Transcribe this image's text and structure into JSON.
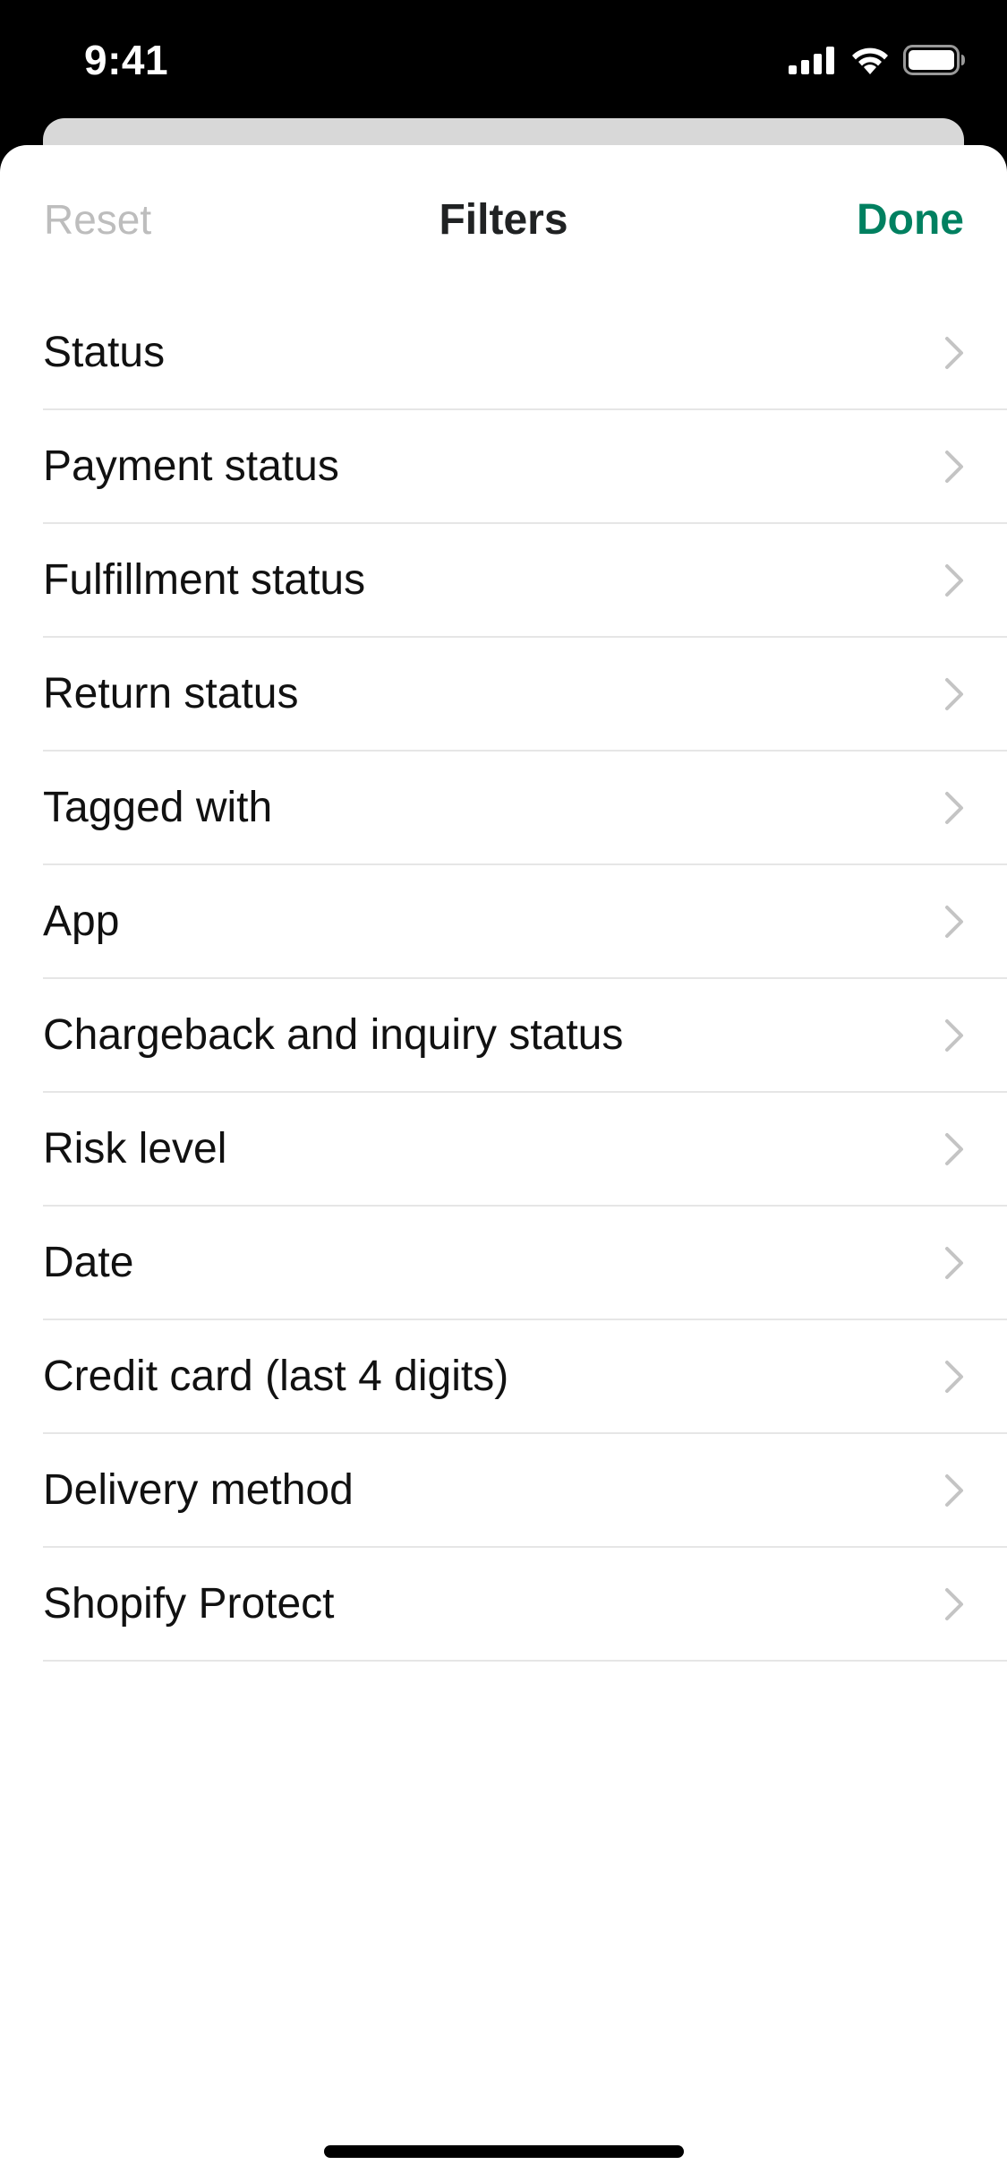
{
  "status_bar": {
    "time": "9:41",
    "icons": [
      "cellular-signal-icon",
      "wifi-icon",
      "battery-icon"
    ]
  },
  "sheet": {
    "reset_label": "Reset",
    "title": "Filters",
    "done_label": "Done",
    "colors": {
      "accent": "#008060",
      "reset_disabled": "#bdbdbd",
      "chevron": "#c4c4c4"
    }
  },
  "filters": [
    {
      "label": "Status"
    },
    {
      "label": "Payment status"
    },
    {
      "label": "Fulfillment status"
    },
    {
      "label": "Return status"
    },
    {
      "label": "Tagged with"
    },
    {
      "label": "App"
    },
    {
      "label": "Chargeback and inquiry status"
    },
    {
      "label": "Risk level"
    },
    {
      "label": "Date"
    },
    {
      "label": "Credit card (last 4 digits)"
    },
    {
      "label": "Delivery method"
    },
    {
      "label": "Shopify Protect"
    }
  ]
}
